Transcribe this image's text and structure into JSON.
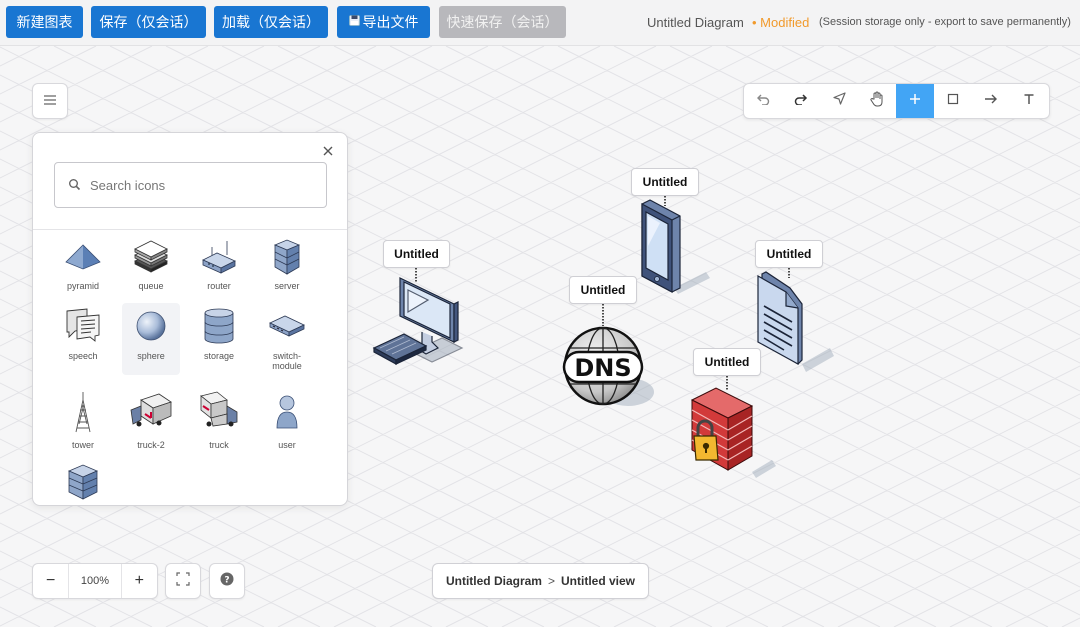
{
  "toolbar": {
    "buttons": [
      {
        "label": "新建图表",
        "disabled": false
      },
      {
        "label": "保存（仅会话）",
        "disabled": false
      },
      {
        "label": "加载（仅会话）",
        "disabled": false
      },
      {
        "label": "导出文件",
        "disabled": false,
        "icon": "save-icon"
      },
      {
        "label": "快速保存（会话）",
        "disabled": true
      }
    ],
    "doc_title": "Untitled Diagram",
    "modified": "• Modified",
    "session_note": "(Session storage only - export to save permanently)"
  },
  "tools": [
    {
      "name": "undo",
      "icon": "undo-icon",
      "active": false
    },
    {
      "name": "redo",
      "icon": "redo-icon",
      "active": false
    },
    {
      "name": "select",
      "icon": "pointer-icon",
      "active": false
    },
    {
      "name": "pan",
      "icon": "hand-icon",
      "active": false
    },
    {
      "name": "add",
      "icon": "plus-icon",
      "active": true
    },
    {
      "name": "rectangle",
      "icon": "square-icon",
      "active": false
    },
    {
      "name": "connector",
      "icon": "arrow-right-icon",
      "active": false
    },
    {
      "name": "text",
      "icon": "text-icon",
      "active": false
    }
  ],
  "icon_panel": {
    "search_placeholder": "Search icons",
    "icons": [
      "pyramid",
      "queue",
      "router",
      "server",
      "speech",
      "sphere",
      "storage",
      "switch-\nmodule",
      "tower",
      "truck-2",
      "truck",
      "user",
      ""
    ]
  },
  "nodes": [
    {
      "label": "Untitled",
      "icon": "desktop-computer-icon"
    },
    {
      "label": "Untitled",
      "icon": "mobile-phone-icon"
    },
    {
      "label": "Untitled",
      "icon": "dns-globe-icon"
    },
    {
      "label": "Untitled",
      "icon": "document-icon"
    },
    {
      "label": "Untitled",
      "icon": "firewall-lock-icon"
    }
  ],
  "zoom": {
    "value": "100%",
    "minus": "−",
    "plus": "+"
  },
  "breadcrumb": {
    "diagram": "Untitled Diagram",
    "separator": ">",
    "view": "Untitled view"
  },
  "dns_text": "DNS",
  "colors": {
    "primary": "#1976d2",
    "active_tool": "#42a5f5",
    "modified": "#f19a2c",
    "disabled": "#b8b8bc"
  }
}
